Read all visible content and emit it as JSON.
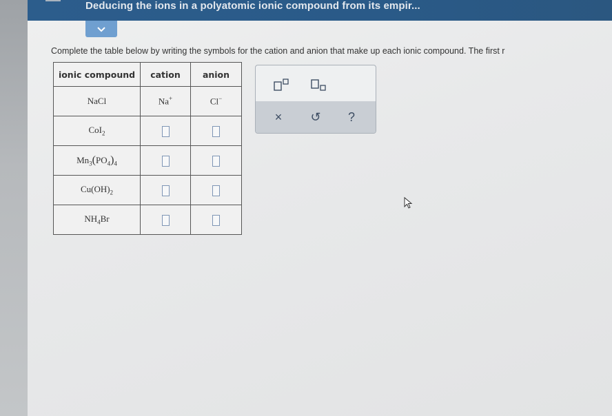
{
  "header": {
    "title": "Deducing the ions in a polyatomic ionic compound from its empir..."
  },
  "instructions": "Complete the table below by writing the symbols for the cation and anion that make up each ionic compound. The first r",
  "table": {
    "headers": [
      "ionic compound",
      "cation",
      "anion"
    ],
    "rows": [
      {
        "compound_parts": [
          "NaCl"
        ],
        "cation": "Na",
        "cation_charge": "+",
        "anion": "Cl",
        "anion_charge": "−"
      },
      {
        "compound_parts": [
          "CoI",
          "2"
        ]
      },
      {
        "compound_parts": [
          "Mn",
          "3",
          "(",
          "PO",
          "4",
          ")",
          "4"
        ]
      },
      {
        "compound_parts": [
          "Cu",
          "(OH)",
          "2"
        ]
      },
      {
        "compound_parts": [
          "NH",
          "4",
          "Br"
        ]
      }
    ]
  },
  "palette": {
    "buttons": {
      "clear": "×",
      "undo": "↺",
      "help": "?"
    }
  },
  "icons": {
    "collapse": "chevron-down-icon",
    "superscript": "superscript-icon",
    "subscript": "subscript-icon",
    "cursor": "mouse-pointer-icon"
  },
  "colors": {
    "topbar": "#2c5d8c",
    "collapse_tab": "#6f9fd0",
    "answer_box_border": "#7e95b5",
    "palette_bottom": "#c9ced4"
  }
}
